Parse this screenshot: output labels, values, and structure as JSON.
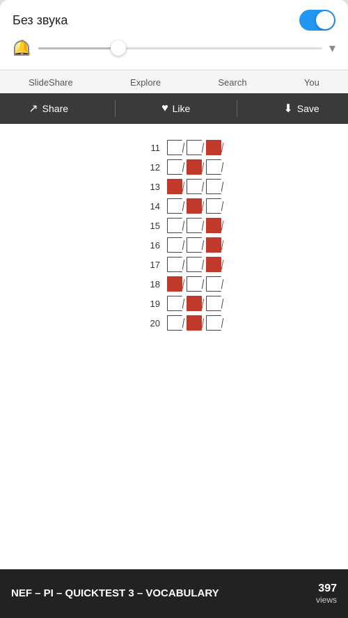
{
  "top_panel": {
    "mute_label": "Без звука",
    "toggle_on": true
  },
  "nav": {
    "items": [
      "SlideShare",
      "Explore",
      "Search",
      "You"
    ]
  },
  "action_bar": {
    "share_label": "Share",
    "like_label": "Like",
    "save_label": "Save"
  },
  "quiz": {
    "rows": [
      {
        "num": 11,
        "cols": [
          false,
          false,
          true
        ]
      },
      {
        "num": 12,
        "cols": [
          false,
          true,
          false
        ]
      },
      {
        "num": 13,
        "cols": [
          true,
          false,
          false
        ]
      },
      {
        "num": 14,
        "cols": [
          false,
          true,
          false
        ]
      },
      {
        "num": 15,
        "cols": [
          false,
          false,
          true
        ]
      },
      {
        "num": 16,
        "cols": [
          false,
          false,
          true
        ]
      },
      {
        "num": 17,
        "cols": [
          false,
          false,
          true
        ]
      },
      {
        "num": 18,
        "cols": [
          true,
          false,
          false
        ]
      },
      {
        "num": 19,
        "cols": [
          false,
          true,
          false
        ]
      },
      {
        "num": 20,
        "cols": [
          false,
          true,
          false
        ]
      }
    ]
  },
  "bottom": {
    "title": "NEF – PI – QUICKTEST 3 – VOCABULARY",
    "views_count": "397",
    "views_label": "views"
  }
}
